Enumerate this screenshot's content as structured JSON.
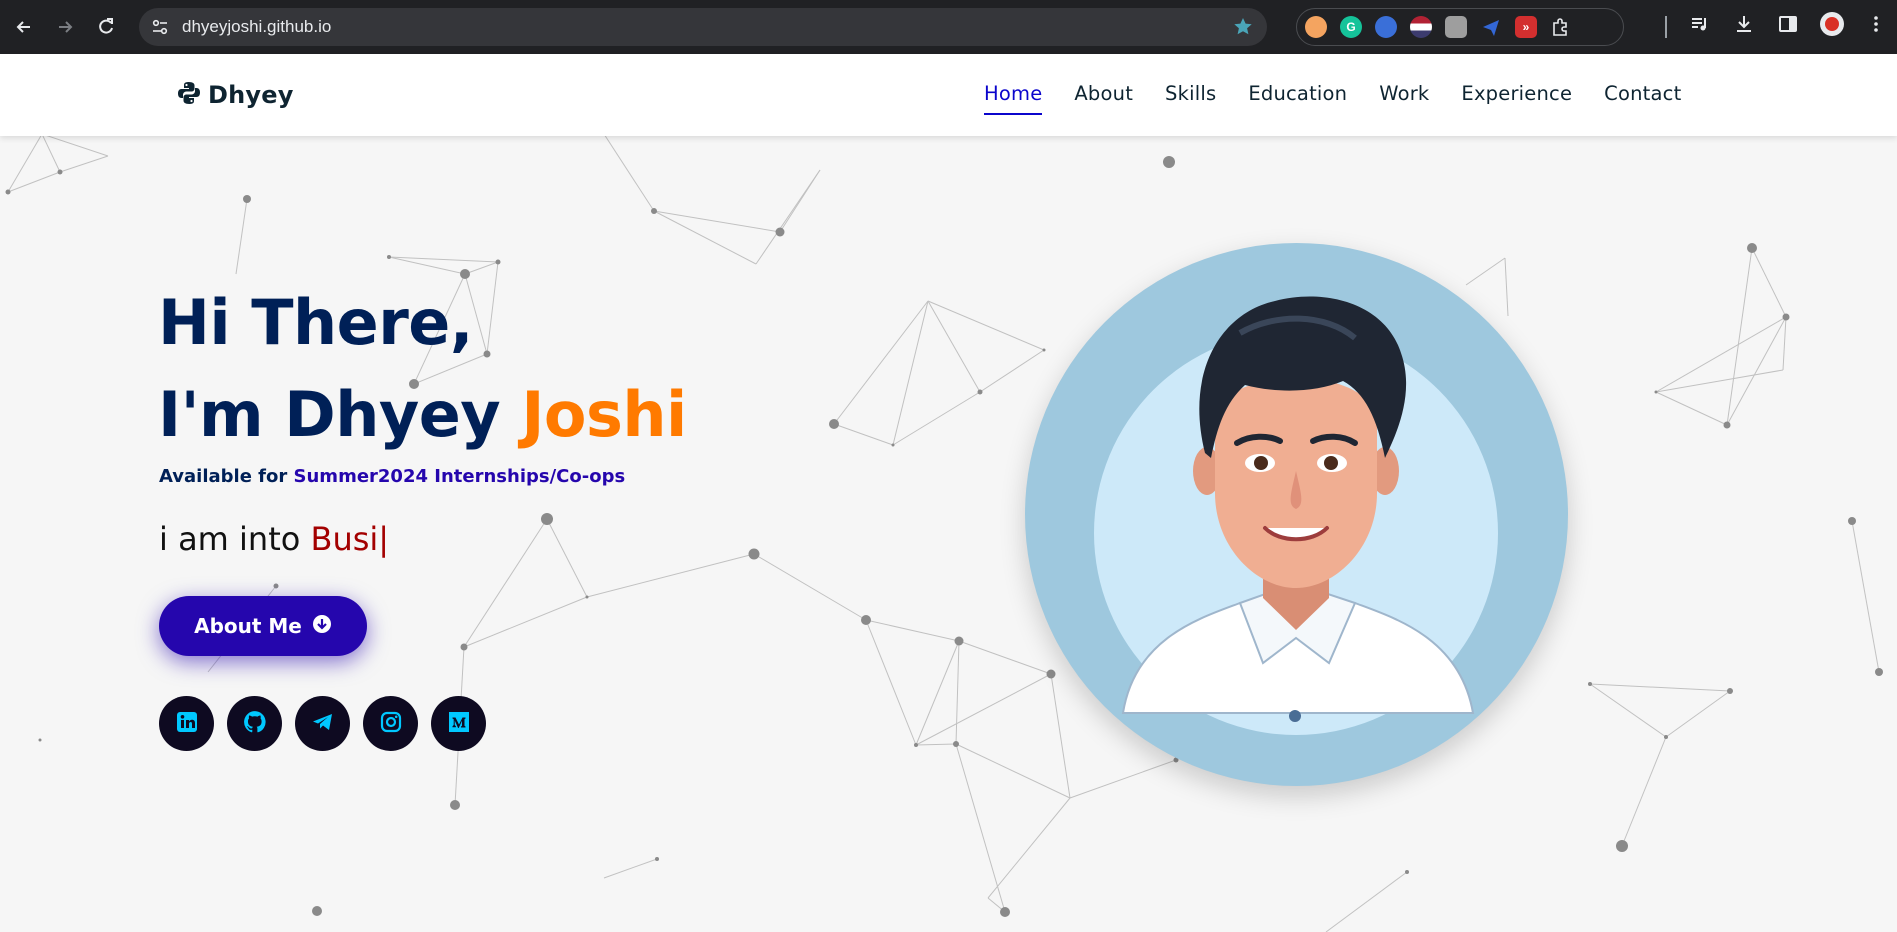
{
  "browser": {
    "url": "dhyeyjoshi.github.io",
    "extensions": [
      "cookie-icon",
      "grammarly-icon",
      "translate-icon",
      "flag-us-icon",
      "clipper-icon",
      "send-icon",
      "video-speed-icon",
      "puzzle-icon"
    ],
    "toolbar_icons": [
      "reading-list-icon",
      "download-icon",
      "side-panel-icon",
      "profile-avatar",
      "menu-kebab-icon"
    ]
  },
  "header": {
    "logo_text": "Dhyey",
    "nav": [
      {
        "label": "Home",
        "active": true
      },
      {
        "label": "About"
      },
      {
        "label": "Skills"
      },
      {
        "label": "Education"
      },
      {
        "label": "Work"
      },
      {
        "label": "Experience"
      },
      {
        "label": "Contact"
      }
    ]
  },
  "hero": {
    "greeting": "Hi There,",
    "intro_prefix": "I'm Dhyey ",
    "intro_accent": "Joshi",
    "availability_prefix": "Available for ",
    "availability_highlight": "Summer2024 Internships/Co-ops",
    "typing_prefix": "i am into ",
    "typing_value": "Busi|",
    "about_button": "About Me",
    "socials": [
      "linkedin-icon",
      "github-icon",
      "telegram-icon",
      "instagram-icon",
      "medium-icon"
    ]
  },
  "colors": {
    "navy": "#002057",
    "accent_orange": "#ff7a00",
    "button_blue": "#2506ad",
    "typed_red": "#a30000",
    "social_icon_cyan": "#00c8ff"
  }
}
